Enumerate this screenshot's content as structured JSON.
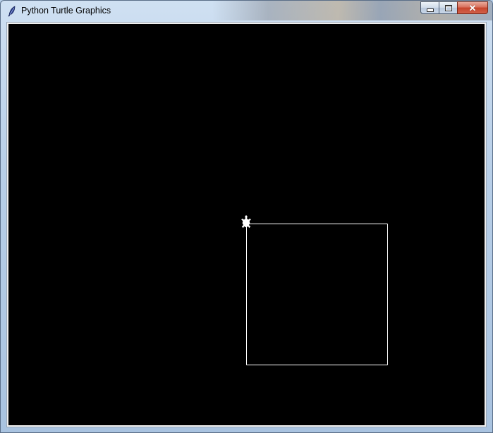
{
  "window": {
    "title": "Python Turtle Graphics",
    "icon": "feather-icon",
    "buttons": {
      "minimize": "minimize-icon",
      "maximize": "maximize-icon",
      "close": "close-icon"
    }
  },
  "canvas": {
    "background_color": "#000000",
    "pen_color": "#ffffff",
    "turtle_color": "#ffffff",
    "turtle_shape": "turtle",
    "drawing": {
      "shape": "square",
      "side": 200,
      "start": [
        0,
        0
      ],
      "heading": 0
    },
    "turtle": {
      "position": [
        0,
        0
      ],
      "heading": 90
    }
  },
  "colors": {
    "titlebar": "#b9d1ea",
    "close_button": "#c6452c"
  }
}
